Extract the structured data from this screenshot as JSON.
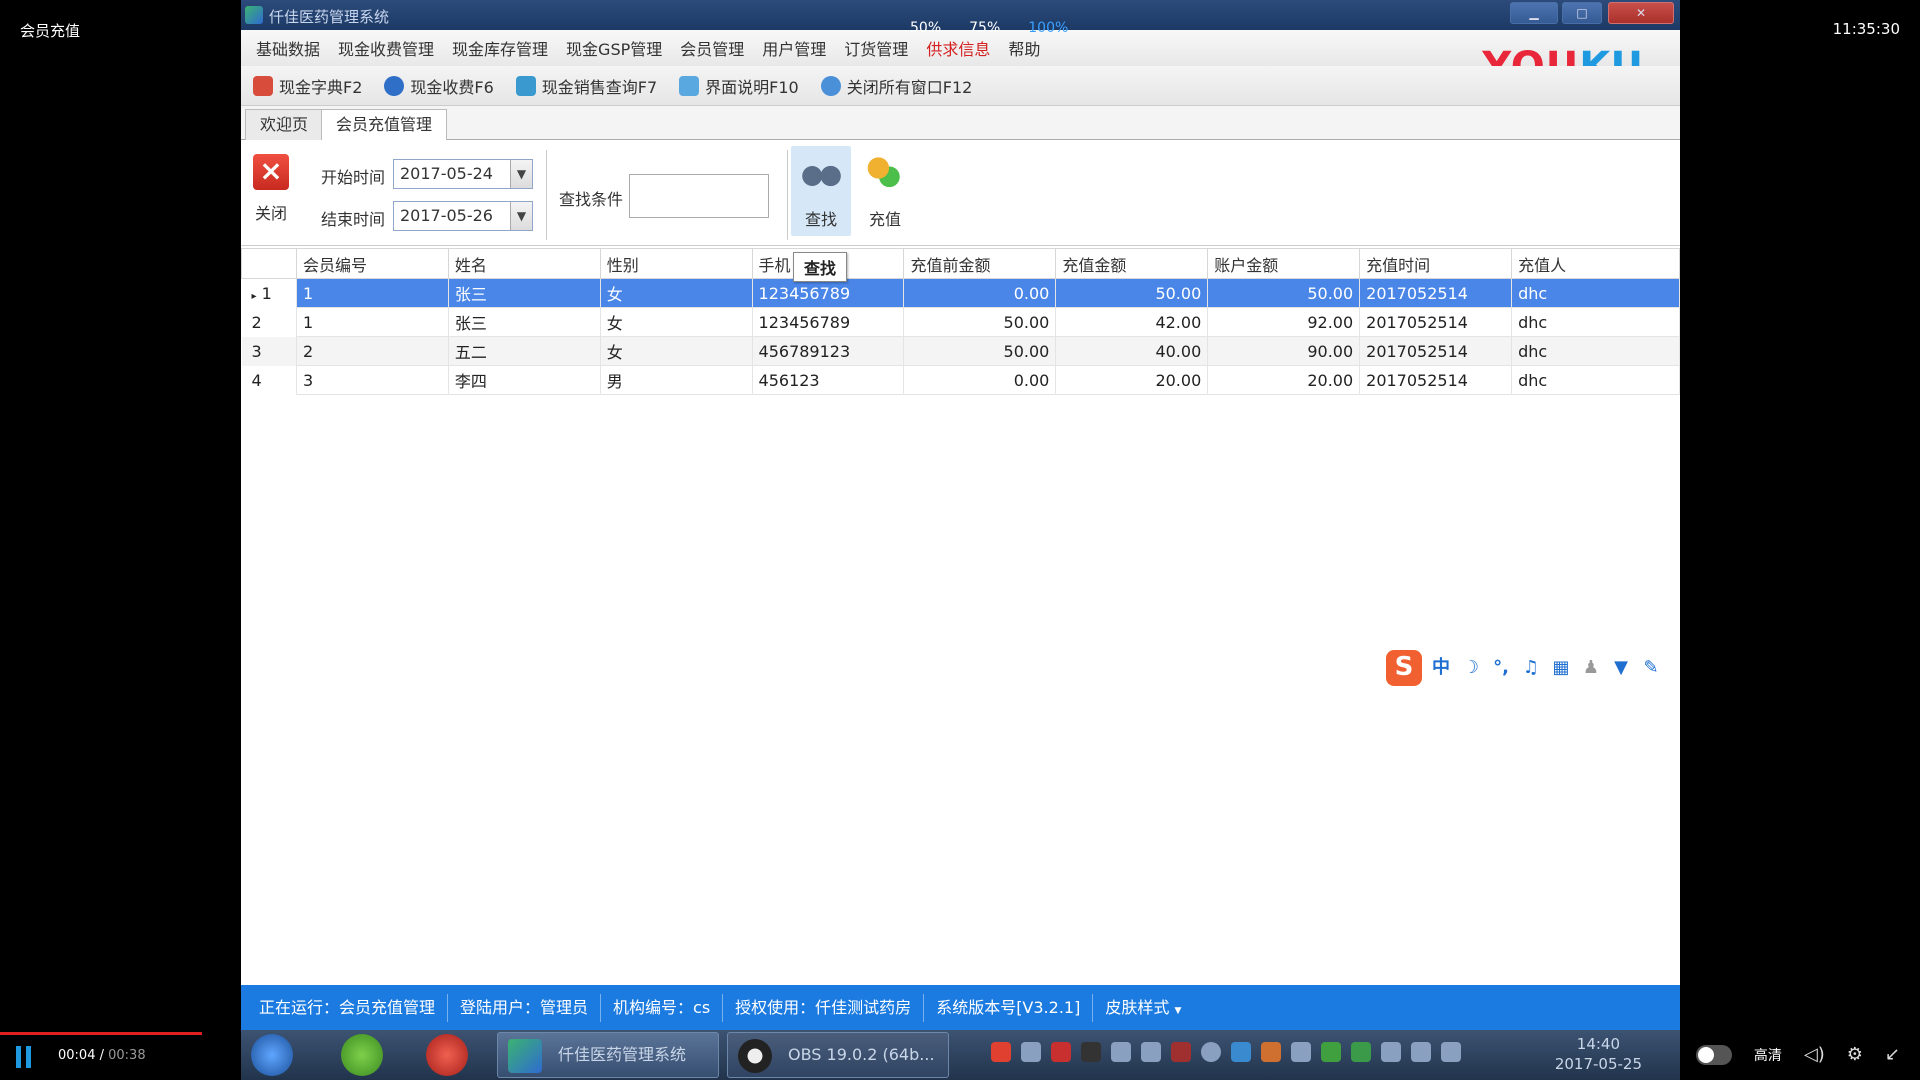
{
  "player": {
    "title": "会员充值",
    "clock": "11:35:30",
    "zoom_levels": [
      "50%",
      "75%",
      "100%"
    ],
    "current_time": "00:04",
    "total_time": "00:38",
    "quality": "高清",
    "progress": 0.105
  },
  "window": {
    "title": "仟佳医药管理系统",
    "menu": [
      "基础数据",
      "现金收费管理",
      "现金库存管理",
      "现金GSP管理",
      "会员管理",
      "用户管理",
      "订货管理",
      "供求信息",
      "帮助"
    ],
    "highlighted_menu": "供求信息",
    "watermark": "YOUKU",
    "toolbar": [
      "现金字典F2",
      "现金收费F6",
      "现金销售查询F7",
      "界面说明F10",
      "关闭所有窗口F12"
    ],
    "tabs": [
      "欢迎页",
      "会员充值管理"
    ],
    "active_tab": "会员充值管理"
  },
  "panel": {
    "close_label": "关闭",
    "start_label": "开始时间",
    "start_date": "2017-05-24",
    "end_label": "结束时间",
    "end_date": "2017-05-26",
    "search_label": "查找条件",
    "search_value": "",
    "find_label": "查找",
    "recharge_label": "充值",
    "tooltip": "查找"
  },
  "grid": {
    "columns": [
      "会员编号",
      "姓名",
      "性别",
      "手机",
      "充值前金额",
      "充值金额",
      "账户金额",
      "充值时间",
      "充值人"
    ],
    "rows": [
      [
        "1",
        "张三",
        "女",
        "123456789",
        "0.00",
        "50.00",
        "50.00",
        "2017052514",
        "dhc"
      ],
      [
        "1",
        "张三",
        "女",
        "123456789",
        "50.00",
        "42.00",
        "92.00",
        "2017052514",
        "dhc"
      ],
      [
        "2",
        "五二",
        "女",
        "456789123",
        "50.00",
        "40.00",
        "90.00",
        "2017052514",
        "dhc"
      ],
      [
        "3",
        "李四",
        "男",
        "456123",
        "0.00",
        "20.00",
        "20.00",
        "2017052514",
        "dhc"
      ]
    ],
    "row_numbers": [
      "1",
      "2",
      "3",
      "4"
    ],
    "selected_row": 0
  },
  "status": [
    "正在运行：会员充值管理",
    "登陆用户：管理员",
    "机构编号：cs",
    "授权使用：仟佳测试药房",
    "系统版本号[V3.2.1]",
    "皮肤样式"
  ],
  "taskbar": {
    "tasks": [
      "仟佳医药管理系统",
      "OBS 19.0.2 (64b..."
    ],
    "time": "14:40",
    "date": "2017-05-25"
  }
}
